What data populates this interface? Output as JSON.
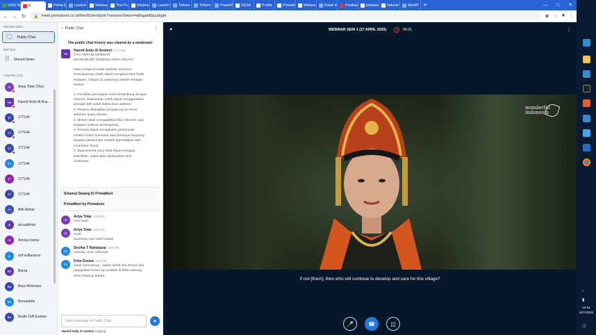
{
  "browser": {
    "tabs": [
      {
        "label": "(530) W",
        "favicon": "whatsapp-icon",
        "color": "green"
      },
      {
        "label": "P",
        "favicon": "record-icon",
        "color": "red",
        "active": true
      },
      {
        "label": "Prima M",
        "favicon": "tab-icon",
        "color": "white"
      },
      {
        "label": "Launch",
        "favicon": "tab-icon",
        "color": "blue"
      },
      {
        "label": "Webina",
        "favicon": "k-icon",
        "color": "white"
      },
      {
        "label": "The Pu",
        "favicon": "k-icon",
        "color": "white"
      },
      {
        "label": "Webina",
        "favicon": "k-icon",
        "color": "white"
      },
      {
        "label": "Launch",
        "favicon": "tab-icon",
        "color": "blue"
      },
      {
        "label": "Telkom",
        "favicon": "tab-icon",
        "color": "blue"
      },
      {
        "label": "Telkom",
        "favicon": "tab-icon",
        "color": "blue"
      },
      {
        "label": "PowerP",
        "favicon": "tab-icon",
        "color": "blue"
      },
      {
        "label": "DESA",
        "favicon": "tab-icon",
        "color": "white"
      },
      {
        "label": "Profile",
        "favicon": "tab-icon",
        "color": "white"
      },
      {
        "label": "PrimaM",
        "favicon": "tab-icon",
        "color": "white"
      },
      {
        "label": "Webina",
        "favicon": "tab-icon",
        "color": "white"
      },
      {
        "label": "Kotak M",
        "favicon": "tab-icon",
        "color": "blue"
      },
      {
        "label": "Finalise",
        "favicon": "gmail-icon",
        "color": "red"
      },
      {
        "label": "behavio",
        "favicon": "google-icon",
        "color": "white"
      },
      {
        "label": "Industri",
        "favicon": "tab-icon",
        "color": "white"
      },
      {
        "label": "WordP",
        "favicon": "tab-icon",
        "color": "blue"
      }
    ],
    "new_tab": "+",
    "url": "meet.primakom.co.id/html5client/join?sessionToken=w8sgab8zjuzkgte"
  },
  "sidebar": {
    "messages_title": "MESSAGES",
    "public_chat": "Public Chat",
    "notes_title": "NOTES",
    "shared_notes": "Shared Notes",
    "users_title": "USERS (32)",
    "users": [
      {
        "initials": "Ar",
        "name": "Ariya Totar (You)",
        "color": "#7a3fb7",
        "badge": true
      },
      {
        "initials": "Ha",
        "name": "Hannif Andy Al Ans...",
        "color": "#5e35b1",
        "square": true,
        "badge": true
      },
      {
        "initials": "17",
        "name": "177144",
        "color": "#3949ab",
        "badge": true
      },
      {
        "initials": "17",
        "name": "177144",
        "color": "#3949ab",
        "badge": true
      },
      {
        "initials": "17",
        "name": "177144",
        "color": "#3949ab",
        "badge": true
      },
      {
        "initials": "17",
        "name": "177144",
        "color": "#1e88e5"
      },
      {
        "initials": "17",
        "name": "177144",
        "color": "#8e24aa"
      },
      {
        "initials": "17",
        "name": "177144",
        "color": "#3949ab"
      },
      {
        "initials": "Ai",
        "name": "Aldi Adrian",
        "color": "#3f51b5"
      },
      {
        "initials": "al",
        "name": "ali subkhan",
        "color": "#5e35b1"
      },
      {
        "initials": "An",
        "name": "Annisa hosna",
        "color": "#8e24aa"
      },
      {
        "initials": "ar",
        "name": "arif sulfiantono",
        "color": "#1e88e5"
      },
      {
        "initials": "Ba",
        "name": "Barna",
        "color": "#5e35b1"
      },
      {
        "initials": "Ba",
        "name": "Bayu Wisnawa",
        "color": "#3949ab"
      },
      {
        "initials": "Be",
        "name": "Bernadette",
        "color": "#1e88e5"
      },
      {
        "initials": "Bu",
        "name": "Budhi Toffl Exebler",
        "color": "#3949ab"
      }
    ]
  },
  "chat": {
    "back_label": "Public Chat",
    "cleared_notice": "The public chat history was cleared by a moderator",
    "main_message": {
      "initials": "Ha",
      "sender": "Hannif Andy Al Anshori",
      "time": "3:17 PM",
      "lines": [
        "TATA TERTIB WEBINAR",
        "NGABUBURIT BARENG DESA WISATA",
        "",
        "Saat mengikuti kelas webinar, dimohon",
        "kesediaannya untuk dapat mengikuti Tata Tertib",
        "kegiatan. Adapun di antaranya adalah sebagai",
        "berikut.",
        "",
        "1. Posisikan perangkat Anda tersambung dengan",
        "internet. Disarankan untuk dapat menggunakan",
        "jaringan Wifi untuk kelancaran webinar",
        "2. Peserta diharapkan bergabung 15 menit",
        "sebelum acara dimulai",
        "3. Mohon tidak mengaktifkan fitur mikrofon saat",
        "kegiatan webinar berlangsung",
        "4. Peserta dapat mengajukan pertanyaan",
        "melalui kolom komentar atau bertanya langsung",
        "kepada narasumber setelah dipersilakan oleh",
        "moderator (host)",
        "5. Bagi peserta yang tidak dapat menjaga",
        "ketertiban, maka akan dikeluarkan oleh",
        "moderator."
      ]
    },
    "welcome_lines": [
      "Selamat Datang Di PrimaMeet",
      "PrimaMeet by Primakom"
    ],
    "messages": [
      {
        "initials": "Ar",
        "sender": "Ariya Totar",
        "time": "3:50 PM",
        "color": "#7a3fb7",
        "lines": [
          "mas hanif"
        ]
      },
      {
        "initials": "Ar",
        "sender": "Ariya Totar",
        "time": "3:50 PM",
        "color": "#7a3fb7",
        "lines": [
          "mute",
          "suaranya mas hanif masuk"
        ]
      },
      {
        "initials": "De",
        "sender": "Destha T Raharjana",
        "time": "3:51 PM",
        "color": "#1e88e5",
        "lines": [
          "mantap, clear videonya"
        ]
      },
      {
        "initials": "Fe",
        "sender": "Febe Donna",
        "time": "3:51 PM",
        "color": "#1e88e5",
        "lines": [
          "salam semuanya... salam kenal dari Donna dari",
          "pagayuban Ketan Ayu praktisi di Ratu Lawang",
          "desa Tanjung Jepara"
        ]
      }
    ],
    "input_placeholder": "Send message to Public Chat",
    "typing_user": "Hannif Andy Al Anshori",
    "typing_text": "is typing"
  },
  "presentation": {
    "title": "WEBINAR SERI 1 (27 APRIL 2020)",
    "recording_time": "04:31",
    "logo_line1": "wonderful",
    "logo_line2": "indonesia",
    "subtitle": "If not [them], then who will continue to develop and care for this village?"
  },
  "taskbar": {
    "time": "15:51",
    "date": "4/27/2020"
  }
}
